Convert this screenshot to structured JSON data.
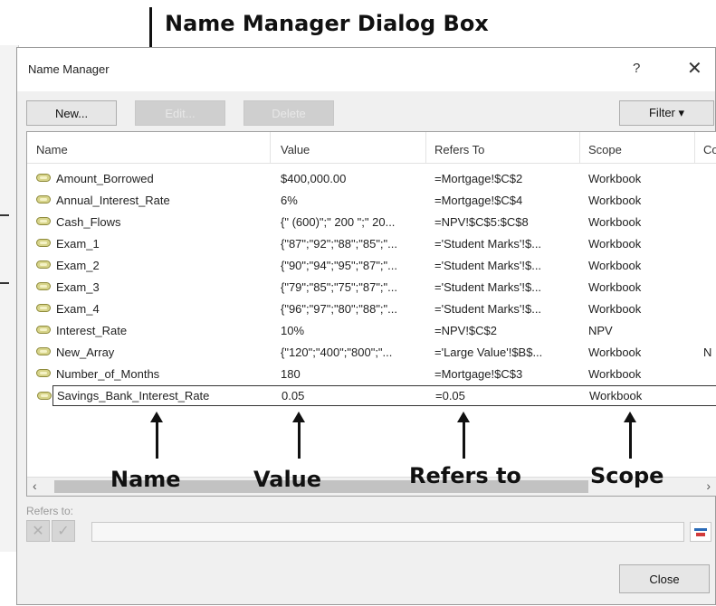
{
  "annotation": {
    "title": "Name Manager Dialog Box",
    "labels": {
      "name": "Name",
      "value": "Value",
      "refers_to": "Refers to",
      "scope": "Scope"
    }
  },
  "dialog": {
    "title": "Name Manager",
    "help": "?",
    "close_glyph": "✕"
  },
  "toolbar": {
    "new": "New...",
    "edit": "Edit...",
    "delete": "Delete",
    "filter": "Filter ▾"
  },
  "columns": [
    "Name",
    "Value",
    "Refers To",
    "Scope",
    "Co"
  ],
  "rows": [
    {
      "name": "Amount_Borrowed",
      "value": "$400,000.00",
      "refers": "=Mortgage!$C$2",
      "scope": "Workbook",
      "comment": ""
    },
    {
      "name": "Annual_Interest_Rate",
      "value": "6%",
      "refers": "=Mortgage!$C$4",
      "scope": "Workbook",
      "comment": ""
    },
    {
      "name": "Cash_Flows",
      "value": "{\" (600)\";\" 200 \";\" 20...",
      "refers": "=NPV!$C$5:$C$8",
      "scope": "Workbook",
      "comment": ""
    },
    {
      "name": "Exam_1",
      "value": "{\"87\";\"92\";\"88\";\"85\";\"...",
      "refers": "='Student Marks'!$...",
      "scope": "Workbook",
      "comment": ""
    },
    {
      "name": "Exam_2",
      "value": "{\"90\";\"94\";\"95\";\"87\";\"...",
      "refers": "='Student Marks'!$...",
      "scope": "Workbook",
      "comment": ""
    },
    {
      "name": "Exam_3",
      "value": "{\"79\";\"85\";\"75\";\"87\";\"...",
      "refers": "='Student Marks'!$...",
      "scope": "Workbook",
      "comment": ""
    },
    {
      "name": "Exam_4",
      "value": "{\"96\";\"97\";\"80\";\"88\";\"...",
      "refers": "='Student Marks'!$...",
      "scope": "Workbook",
      "comment": ""
    },
    {
      "name": "Interest_Rate",
      "value": "10%",
      "refers": "=NPV!$C$2",
      "scope": "NPV",
      "comment": ""
    },
    {
      "name": "New_Array",
      "value": "{\"120\";\"400\";\"800\";\"...",
      "refers": "='Large Value'!$B$...",
      "scope": "Workbook",
      "comment": "N"
    },
    {
      "name": "Number_of_Months",
      "value": "180",
      "refers": "=Mortgage!$C$3",
      "scope": "Workbook",
      "comment": ""
    },
    {
      "name": "Savings_Bank_Interest_Rate",
      "value": "0.05",
      "refers": "=0.05",
      "scope": "Workbook",
      "comment": ""
    }
  ],
  "scroll": {
    "left": "‹",
    "right": "›"
  },
  "refers_to_label": "Refers to:",
  "refers_to_value": "",
  "refers_buttons": {
    "cancel": "✕",
    "confirm": "✓"
  },
  "close_button": "Close",
  "colors": {
    "selection_border": "#333333",
    "name_icon": "#d7d48a"
  }
}
